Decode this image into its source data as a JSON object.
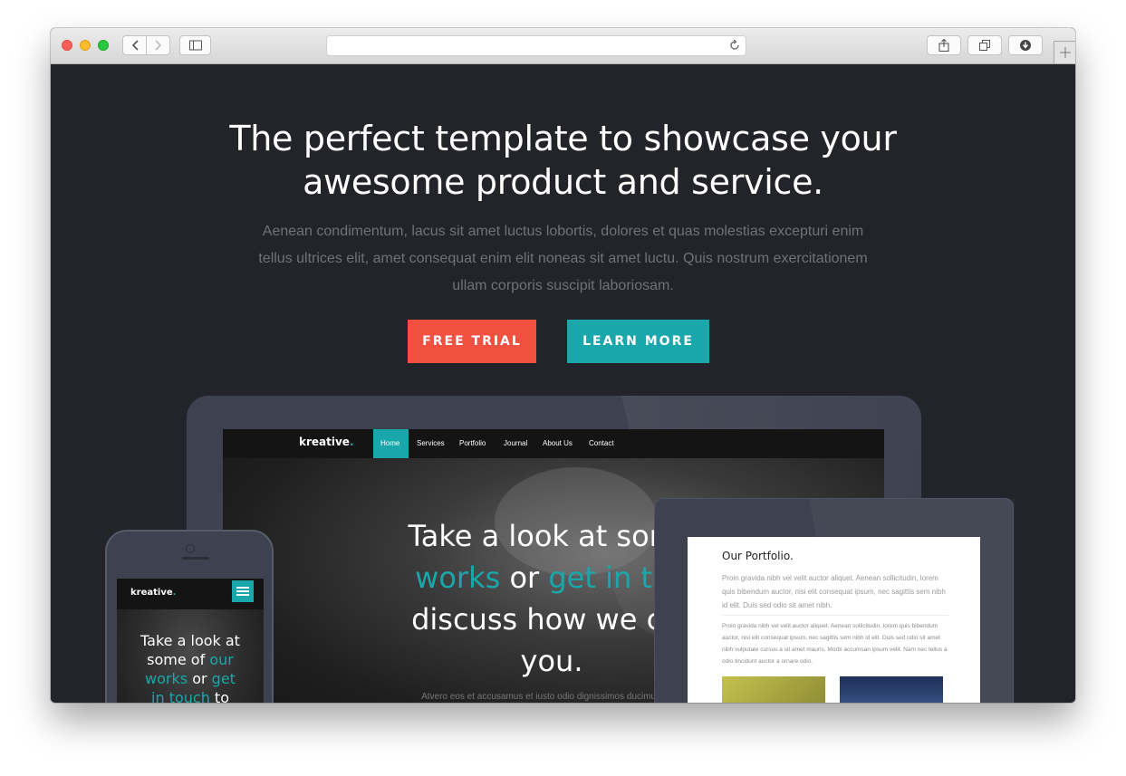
{
  "browser": {
    "address": ""
  },
  "hero": {
    "title_line1": "The perfect template to showcase your",
    "title_line2": "awesome product and service.",
    "subtitle": "Aenean condimentum, lacus sit amet luctus lobortis, dolores et quas molestias excepturi enim tellus ultrices elit, amet consequat enim elit noneas sit amet luctu. Quis nostrum exercitationem ullam corporis suscipit laboriosam.",
    "free_trial_label": "FREE TRIAL",
    "learn_more_label": "LEARN MORE"
  },
  "laptop_site": {
    "logo": "kreative",
    "logo_dot": ".",
    "nav": [
      "Home",
      "Services",
      "Portfolio",
      "Journal",
      "About Us",
      "Contact"
    ],
    "headline_a": "Take a look at some",
    "headline_b1": "works",
    "headline_b2": " or ",
    "headline_b3": "get in tou",
    "headline_c": "discuss how we car",
    "headline_d": "you.",
    "small_text": "Atvero eos et accusamus et iusto odio dignissimos ducimus qui blan"
  },
  "phone_site": {
    "logo": "kreative",
    "logo_dot": ".",
    "head_1": "Take a look at",
    "head_2a": "some of ",
    "head_2b": "our",
    "head_3a": "works",
    "head_3b": " or ",
    "head_3c": "get",
    "head_4a": "in touch",
    "head_4b": " to"
  },
  "tablet_site": {
    "title": "Our Portfolio.",
    "para1": "Proin gravida nibh vel velit auctor aliquet. Aenean sollicitudin, lorem quis bibendum auctor, nisi elit consequat ipsum, nec sagittis sem nibh id elit. Duis sed odio sit amet nibh.",
    "para2": "Proin gravida nibh vel velit auctor aliquet. Aenean sollicitudin, lorem quis bibendum auctor, nisi elit consequat ipsum, nec sagittis sem nibh id elit. Duis sed odio sit amet nibh vulputate cursus a sit amet mauris. Morbi accumsan ipsum velit. Nam nec tellus a odio tincidunt auctor a ornare odio."
  },
  "colors": {
    "accent_red": "#f25040",
    "accent_teal": "#1aa7ab",
    "background": "#222429"
  }
}
